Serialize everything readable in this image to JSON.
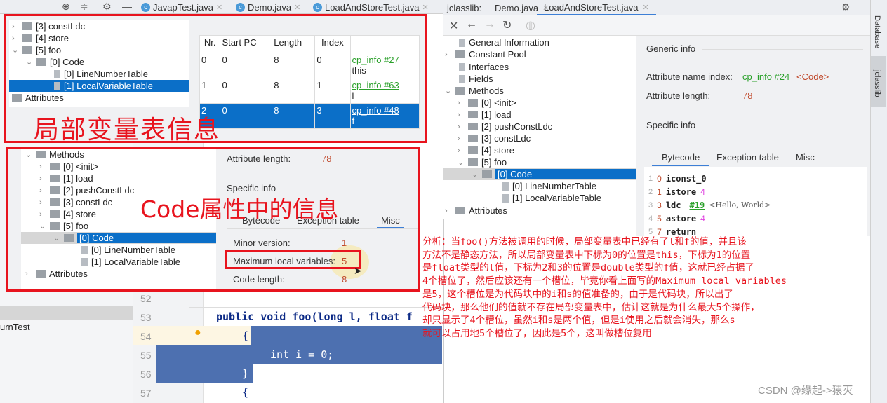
{
  "left_toolbar": {
    "icons": [
      "crosshair-icon",
      "collapse-icon",
      "gear-icon",
      "minimize-icon"
    ]
  },
  "editor_tabs": [
    {
      "label": "JavapTest.java"
    },
    {
      "label": "Demo.java"
    },
    {
      "label": "LoadAndStoreTest.java"
    }
  ],
  "project": {
    "partial_item": "urnTest"
  },
  "box1": {
    "tree": [
      "[3] constLdc",
      "[4] store",
      "[5] foo",
      "[0] Code",
      "[0] LineNumberTable",
      "[1] LocalVariableTable",
      "Attributes"
    ],
    "table": {
      "headers": [
        "Nr.",
        "Start PC",
        "Length",
        "Index",
        ""
      ],
      "rows": [
        [
          "0",
          "0",
          "8",
          "0",
          "cp_info #27",
          "this"
        ],
        [
          "1",
          "0",
          "8",
          "1",
          "cp_info #63",
          "l"
        ],
        [
          "2",
          "0",
          "8",
          "3",
          "cp_info #48",
          "f"
        ]
      ]
    },
    "caption": "局部变量表信息"
  },
  "box2": {
    "tree": [
      "Methods",
      "[0] <init>",
      "[1] load",
      "[2] pushConstLdc",
      "[3] constLdc",
      "[4] store",
      "[5] foo",
      "[0] Code",
      "[0] LineNumberTable",
      "[1] LocalVariableTable",
      "Attributes"
    ],
    "attr_length_label": "Attribute length:",
    "attr_length": "78",
    "specific_info": "Specific info",
    "tabs": [
      "Bytecode",
      "Exception table",
      "Misc"
    ],
    "misc": [
      {
        "label": "Minor version:",
        "value": "1"
      },
      {
        "label": "Maximum local variables:",
        "value": "5"
      },
      {
        "label": "Code length:",
        "value": "8"
      }
    ],
    "caption": "Code属性中的信息"
  },
  "editor": {
    "line_numbers": [
      "52",
      "53",
      "54",
      "55",
      "56",
      "57"
    ],
    "lines": {
      "l53": "public void foo(long l, float f",
      "l54": "{",
      "l55": "int i = 0;",
      "l56": "}",
      "l57": "{"
    }
  },
  "jclasslib": {
    "title": "jclasslib:",
    "tabs": [
      "Demo.java",
      "LoadAndStoreTest.java"
    ],
    "toolbar": [
      "close-icon",
      "back-icon",
      "forward-icon",
      "refresh-icon",
      "web-icon"
    ],
    "tree": [
      "General Information",
      "Constant Pool",
      "Interfaces",
      "Fields",
      "Methods",
      "[0] <init>",
      "[1] load",
      "[2] pushConstLdc",
      "[3] constLdc",
      "[4] store",
      "[5] foo",
      "[0] Code",
      "[0] LineNumberTable",
      "[1] LocalVariableTable",
      "Attributes"
    ],
    "generic_info": "Generic info",
    "attr_name_label": "Attribute name index:",
    "attr_name_link": "cp_info #24",
    "attr_name_value": "<Code>",
    "attr_length_label": "Attribute length:",
    "attr_length": "78",
    "specific_info": "Specific info",
    "tabs2": [
      "Bytecode",
      "Exception table",
      "Misc"
    ],
    "bytecode": [
      {
        "line": "1",
        "pc": "0",
        "op": "iconst_0",
        "arg": "",
        "ref": "",
        "comment": ""
      },
      {
        "line": "2",
        "pc": "1",
        "op": "istore",
        "arg": "4",
        "ref": "",
        "comment": ""
      },
      {
        "line": "3",
        "pc": "3",
        "op": "ldc",
        "arg": "",
        "ref": "#19",
        "comment": "<Hello, World>"
      },
      {
        "line": "4",
        "pc": "5",
        "op": "astore",
        "arg": "4",
        "ref": "",
        "comment": ""
      },
      {
        "line": "5",
        "pc": "7",
        "op": "return",
        "arg": "",
        "ref": "",
        "comment": ""
      }
    ]
  },
  "side_tools": [
    "Database",
    "jclasslib"
  ],
  "note": "分析：当foo()方法被调用的时候，局部变量表中已经有了l和f的值，并且该\n方法不是静态方法，所以局部变量表中下标为0的位置是this，下标为1的位置\n是float类型的l值，下标为2和3的位置是double类型的f值，这就已经占据了\n4个槽位了，然后应该还有一个槽位，毕竟你看上面写的Maximum local variables\n是5，这个槽位是为代码块中的i和s的值准备的，由于是代码块，所以出了\n代码块，那么他们的值就不存在局部变量表中，估计这就是为什么最大5个操作，\n却只显示了4个槽位，虽然i和s是两个值，但是i使用之后就会消失，那么s\n就可以占用地5个槽位了，因此是5个，这叫做槽位复用",
  "watermark": "CSDN @缘起->猿灭",
  "colors": {
    "accent": "#0b6fc8",
    "annotation": "#e8141e",
    "link": "#2aa02a"
  }
}
